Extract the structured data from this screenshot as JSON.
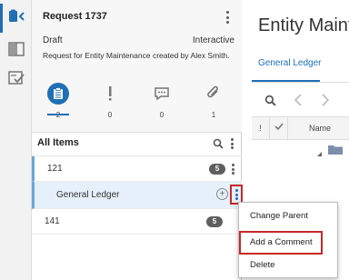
{
  "request": {
    "title": "Request 1737",
    "status": "Draft",
    "type": "Interactive",
    "description": "Request for Entity Maintenance created by Alex Smith.",
    "icons": [
      {
        "name": "clipboard-icon",
        "count": "2"
      },
      {
        "name": "exclamation-icon",
        "count": "0"
      },
      {
        "name": "comment-icon",
        "count": "0"
      },
      {
        "name": "paperclip-icon",
        "count": "1"
      }
    ]
  },
  "list": {
    "title": "All Items",
    "rows": [
      {
        "label": "121",
        "badge": "5"
      },
      {
        "label": "General Ledger"
      },
      {
        "label": "141",
        "badge": "5"
      }
    ]
  },
  "menu": {
    "items": [
      "Change Parent",
      "Add a Comment",
      "Delete"
    ]
  },
  "main": {
    "title": "Entity Maintenance",
    "tab": "General Ledger",
    "column_name": "Name",
    "column_bang": "!"
  },
  "colors": {
    "accent": "#1f6fb5",
    "highlight": "#c62828"
  }
}
